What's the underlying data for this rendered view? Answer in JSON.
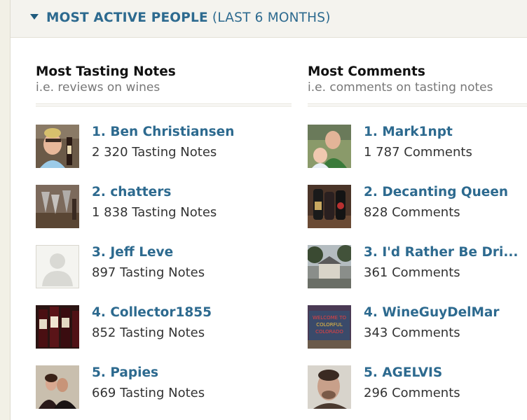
{
  "header": {
    "title": "MOST ACTIVE PEOPLE",
    "subtitle": "(LAST 6 MONTHS)"
  },
  "tasting": {
    "title": "Most Tasting Notes",
    "subtitle": "i.e. reviews on wines",
    "items": [
      {
        "name": "1. Ben Christiansen",
        "count": "2 320 Tasting Notes"
      },
      {
        "name": "2. chatters",
        "count": "1 838 Tasting Notes"
      },
      {
        "name": "3. Jeff Leve",
        "count": "897 Tasting Notes"
      },
      {
        "name": "4. Collector1855",
        "count": "852 Tasting Notes"
      },
      {
        "name": "5. Papies",
        "count": "669 Tasting Notes"
      }
    ]
  },
  "comments": {
    "title": "Most Comments",
    "subtitle": "i.e. comments on tasting notes",
    "items": [
      {
        "name": "1. Mark1npt",
        "count": "1 787 Comments"
      },
      {
        "name": "2. Decanting Queen",
        "count": "828 Comments"
      },
      {
        "name": "3. I'd Rather Be Dri...",
        "count": "361 Comments"
      },
      {
        "name": "4. WineGuyDelMar",
        "count": "343 Comments"
      },
      {
        "name": "5. AGELVIS",
        "count": "296 Comments"
      }
    ]
  },
  "avatar_images": {
    "welcome_sign": "WELCOME TO COLORFUL COLORADO"
  }
}
